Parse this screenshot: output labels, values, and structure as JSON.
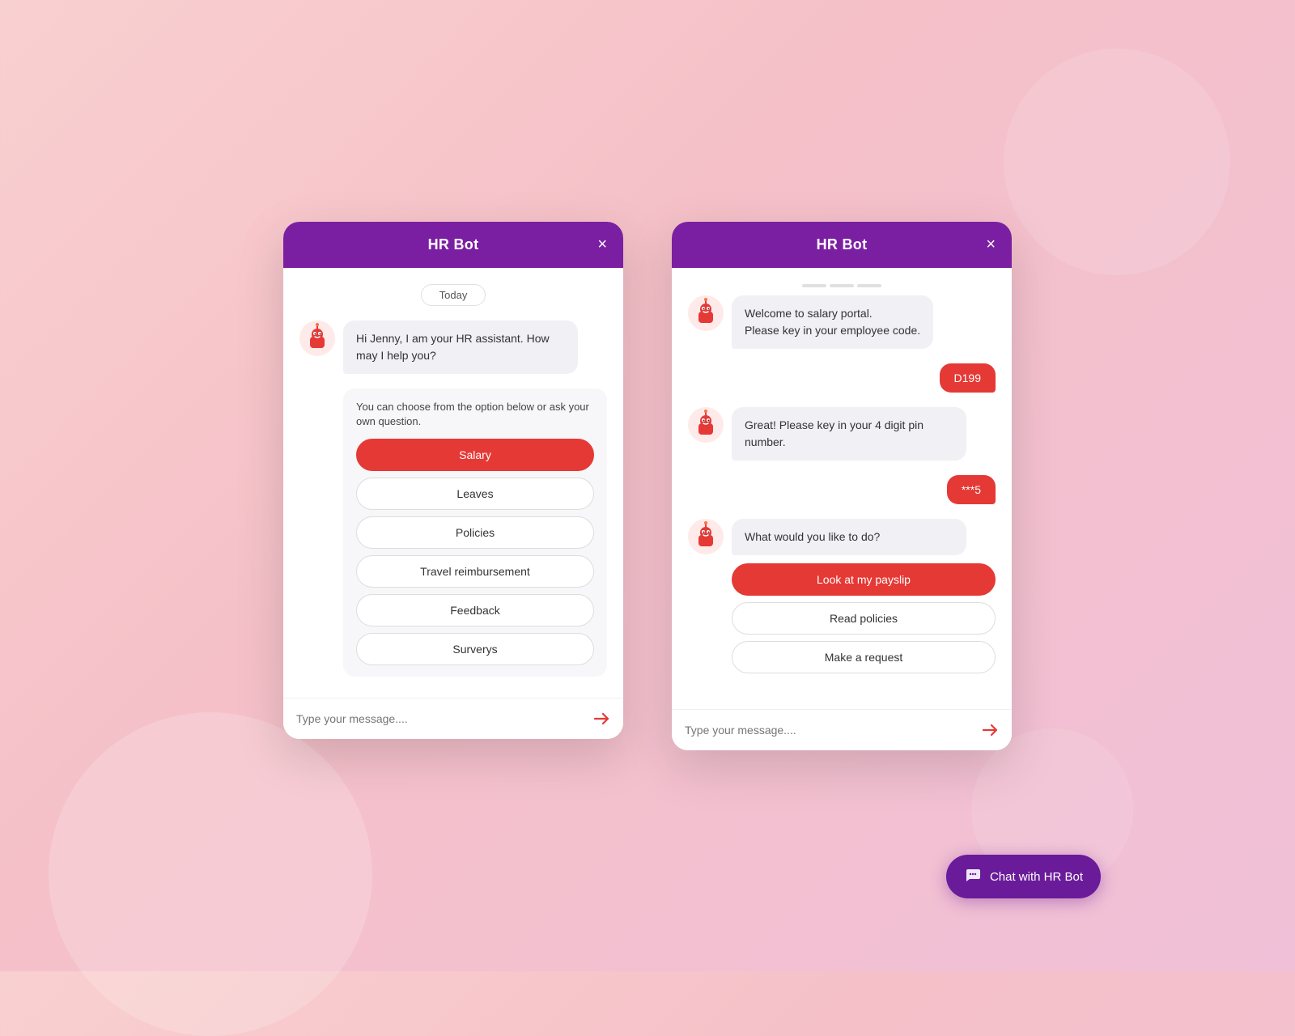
{
  "background": {
    "color_start": "#f9d0d0",
    "color_end": "#f0c0d8"
  },
  "left_panel": {
    "title": "HR Bot",
    "close_label": "×",
    "date_badge": "Today",
    "bot_greeting": "Hi Jenny, I am your HR assistant. How may I help you?",
    "options_intro": "You can choose from the option below or ask your own question.",
    "options": [
      {
        "label": "Salary",
        "active": true
      },
      {
        "label": "Leaves",
        "active": false
      },
      {
        "label": "Policies",
        "active": false
      },
      {
        "label": "Travel reimbursement",
        "active": false
      },
      {
        "label": "Feedback",
        "active": false
      },
      {
        "label": "Surverys",
        "active": false
      }
    ],
    "input_placeholder": "Type your message....",
    "send_label": "➤"
  },
  "right_panel": {
    "title": "HR Bot",
    "close_label": "×",
    "scroll_hint": "...",
    "messages": [
      {
        "type": "bot",
        "text": "Welcome to salary portal.\nPlease key in your employee code."
      },
      {
        "type": "user",
        "text": "D199"
      },
      {
        "type": "bot",
        "text": "Great! Please key in your 4 digit pin number."
      },
      {
        "type": "user",
        "text": "***5"
      },
      {
        "type": "bot",
        "text": "What would you like to do?"
      }
    ],
    "options": [
      {
        "label": "Look at my payslip",
        "active": true
      },
      {
        "label": "Read policies",
        "active": false
      },
      {
        "label": "Make a request",
        "active": false
      }
    ],
    "input_placeholder": "Type your message....",
    "send_label": "➤"
  },
  "fab": {
    "label": "Chat with HR Bot",
    "icon": "chat-icon"
  }
}
